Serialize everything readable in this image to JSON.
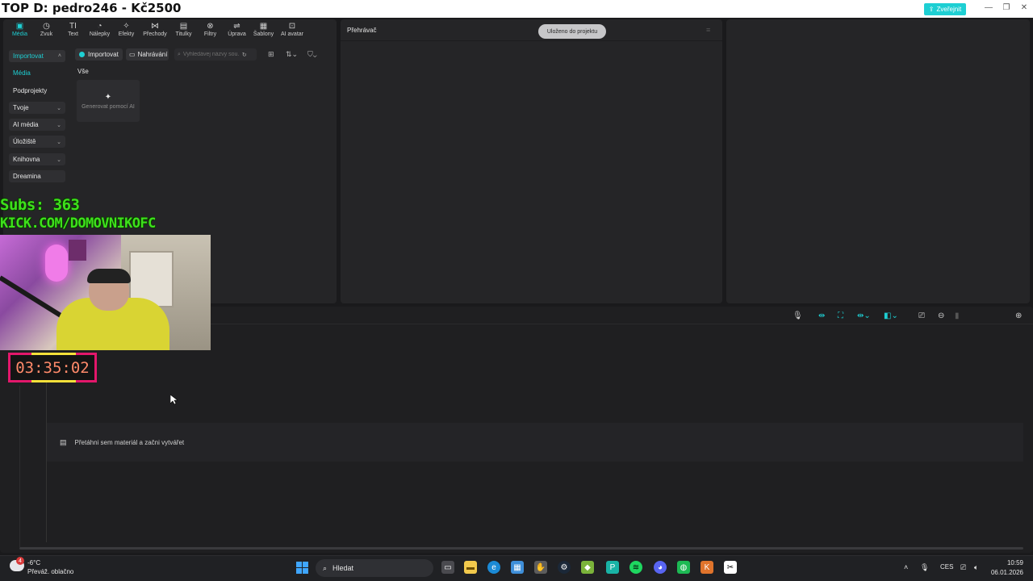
{
  "stream": {
    "title": "TOP D: pedro246 - Kč2500",
    "subs": "Subs: 363",
    "kick": "KICK.COM/DOMOVNIKOFC",
    "timer": "03:35:02"
  },
  "window": {
    "publish_label": "Zveřejnit",
    "accent": "#1ecfd3"
  },
  "toolbar": {
    "items": [
      {
        "label": "Média",
        "icon": "media-icon"
      },
      {
        "label": "Zvuk",
        "icon": "audio-icon"
      },
      {
        "label": "Text",
        "icon": "text-icon"
      },
      {
        "label": "Nálepky",
        "icon": "stickers-icon"
      },
      {
        "label": "Efekty",
        "icon": "effects-icon"
      },
      {
        "label": "Přechody",
        "icon": "transitions-icon"
      },
      {
        "label": "Titulky",
        "icon": "captions-icon"
      },
      {
        "label": "Filtry",
        "icon": "filters-icon"
      },
      {
        "label": "Úprava",
        "icon": "adjust-icon"
      },
      {
        "label": "Šablony",
        "icon": "templates-icon"
      },
      {
        "label": "AI avatar",
        "icon": "ai-avatar-icon"
      }
    ]
  },
  "sidebar": {
    "items": [
      {
        "label": "Importovat"
      },
      {
        "label": "Média"
      },
      {
        "label": "Podprojekty"
      },
      {
        "label": "Tvoje"
      },
      {
        "label": "AI média"
      },
      {
        "label": "Úložiště"
      },
      {
        "label": "Knihovna"
      },
      {
        "label": "Dreamina"
      }
    ]
  },
  "media": {
    "import_label": "Importovat",
    "record_label": "Nahrávání",
    "search_placeholder": "Vyhledávej názvy sou...",
    "section_label": "Vše",
    "generate_label": "Generovat pomocí AI"
  },
  "player": {
    "title": "Přehrávač",
    "saved_label": "Uloženo do projektu"
  },
  "timeline": {
    "drop_hint": "Přetáhni sem materiál a začni vytvářet"
  },
  "taskbar": {
    "temperature": "-6°C",
    "weather_badge": "4",
    "weather": "Převáž. oblačno",
    "search_label": "Hledat",
    "language": "CES",
    "time": "10:59",
    "date": "06.01.2026"
  }
}
